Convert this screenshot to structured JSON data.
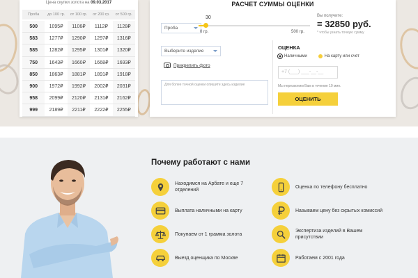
{
  "price_table": {
    "title_prefix": "Цена скупки золота на",
    "title_date": "09.03.2017",
    "headers": [
      "Проба",
      "до 100 гр.",
      "от 100 гр.",
      "от 200 гр.",
      "от 500 гр."
    ],
    "rows": [
      [
        "500",
        "1095₽",
        "1106₽",
        "1112₽",
        "1128₽"
      ],
      [
        "583",
        "1277₽",
        "1290₽",
        "1297₽",
        "1316₽"
      ],
      [
        "585",
        "1282₽",
        "1295₽",
        "1301₽",
        "1320₽"
      ],
      [
        "750",
        "1643₽",
        "1660₽",
        "1668₽",
        "1693₽"
      ],
      [
        "850",
        "1863₽",
        "1881₽",
        "1891₽",
        "1918₽"
      ],
      [
        "900",
        "1972₽",
        "1992₽",
        "2002₽",
        "2031₽"
      ],
      [
        "958",
        "2099₽",
        "2120₽",
        "2131₽",
        "2162₽"
      ],
      [
        "999",
        "2189₽",
        "2211₽",
        "2222₽",
        "2255₽"
      ]
    ]
  },
  "calculator": {
    "title": "РАСЧЕТ СУММЫ ОЦЕНКИ",
    "probe_select": "Проба",
    "weight_value": "30",
    "slider": {
      "min_label": "0 гр.",
      "max_label": "500 гр.",
      "fraction": 0.06
    },
    "receive_label": "Вы получите:",
    "receive_sum": "= 32850 руб.",
    "receive_note": "* чтобы узнать точную сумму",
    "item_select": "Выберите изделие",
    "photo_link": "Прикрепить фото",
    "description_placeholder": "Для более точной оценки опишите здесь изделие",
    "estimate_title": "ОЦЕНКА",
    "payment_options": [
      "Наличными",
      "На карту или счет"
    ],
    "selected_payment": 0,
    "phone_placeholder": "+7 (___) ___-__-__",
    "callback_note": "Мы перезвоним Вам в течение 10 мин.",
    "submit_label": "ОЦЕНИТЬ"
  },
  "why_us": {
    "title": "Почему работают с нами",
    "features": [
      {
        "icon": "location-pin-icon",
        "text": "Находимся на Арбате и еще 7 отделений"
      },
      {
        "icon": "phone-icon",
        "text": "Оценка по телефону бесплатно"
      },
      {
        "icon": "credit-card-icon",
        "text": "Выплата наличными на карту"
      },
      {
        "icon": "ruble-icon",
        "text": "Называем цену без скрытых комиссий"
      },
      {
        "icon": "scales-icon",
        "text": "Покупаем от 1 грамма золота"
      },
      {
        "icon": "magnifier-icon",
        "text": "Экспертиза изделий в Вашем присутствии"
      },
      {
        "icon": "car-icon",
        "text": "Выезд оценщика по Москве"
      },
      {
        "icon": "calendar-icon",
        "text": "Работаем с 2001 года"
      }
    ]
  },
  "colors": {
    "accent": "#f5d03b",
    "slider": "#f5c518",
    "bg_section": "#eef0f2"
  }
}
